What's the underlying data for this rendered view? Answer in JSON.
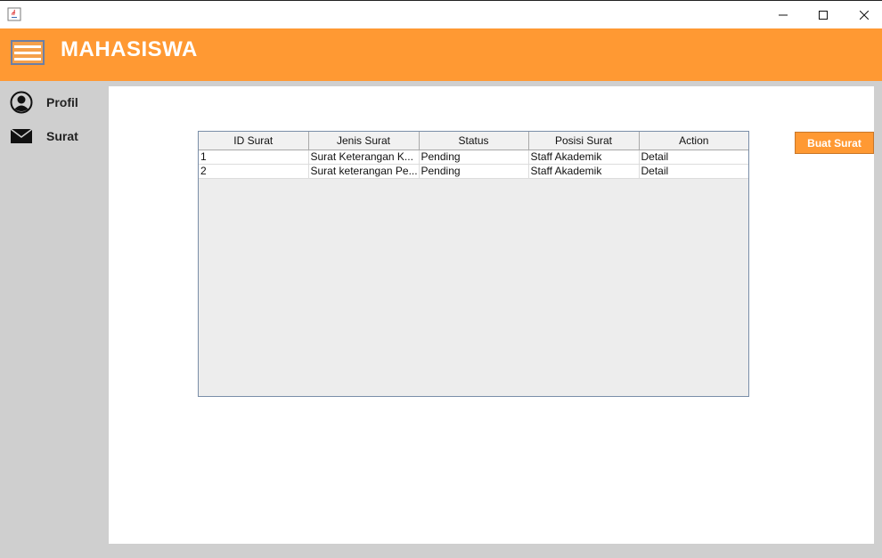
{
  "window": {
    "icon": "java-icon",
    "controls": [
      "minimize-icon",
      "maximize-icon",
      "close-icon"
    ]
  },
  "header": {
    "title": "MAHASISWA",
    "menu_icon": "hamburger-icon",
    "color": "#ff9933"
  },
  "sidebar": {
    "items": [
      {
        "label": "Profil",
        "icon": "user-icon"
      },
      {
        "label": "Surat",
        "icon": "envelope-icon"
      }
    ]
  },
  "table": {
    "columns": [
      "ID Surat",
      "Jenis Surat",
      "Status",
      "Posisi Surat",
      "Action"
    ],
    "rows": [
      [
        "1",
        "Surat Keterangan K...",
        "Pending",
        "Staff Akademik",
        "Detail"
      ],
      [
        "2",
        "Surat keterangan Pe...",
        "Pending",
        "Staff Akademik",
        "Detail"
      ]
    ]
  },
  "actions": {
    "create_label": "Buat Surat"
  }
}
